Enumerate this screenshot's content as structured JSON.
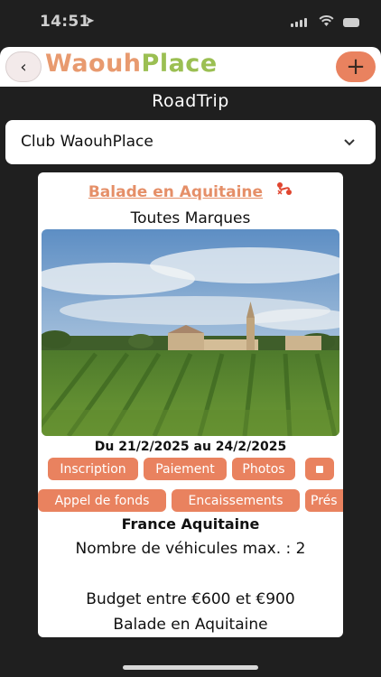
{
  "status": {
    "time": "14:51"
  },
  "header": {
    "logo_part1": "Waouh",
    "logo_part2": "Place"
  },
  "page": {
    "title": "RoadTrip"
  },
  "club_select": {
    "value": "Club WaouhPlace"
  },
  "card": {
    "title": "Balade en Aquitaine",
    "brand": "Toutes Marques",
    "dates": "Du 21/2/2025 au 24/2/2025",
    "buttons_row1": [
      "Inscription",
      "Paiement",
      "Photos"
    ],
    "buttons_row2": [
      "Appel de fonds",
      "Encaissements",
      "Prés"
    ],
    "region": "France Aquitaine",
    "vehicles": "Nombre de véhicules max. : 2",
    "budget": "Budget entre €600 et €900",
    "description": "Balade en Aquitaine"
  },
  "colors": {
    "accent": "#e9825f",
    "logo_orange": "#e89a6f",
    "logo_green": "#9bbf52",
    "background": "#1f1f1f"
  }
}
